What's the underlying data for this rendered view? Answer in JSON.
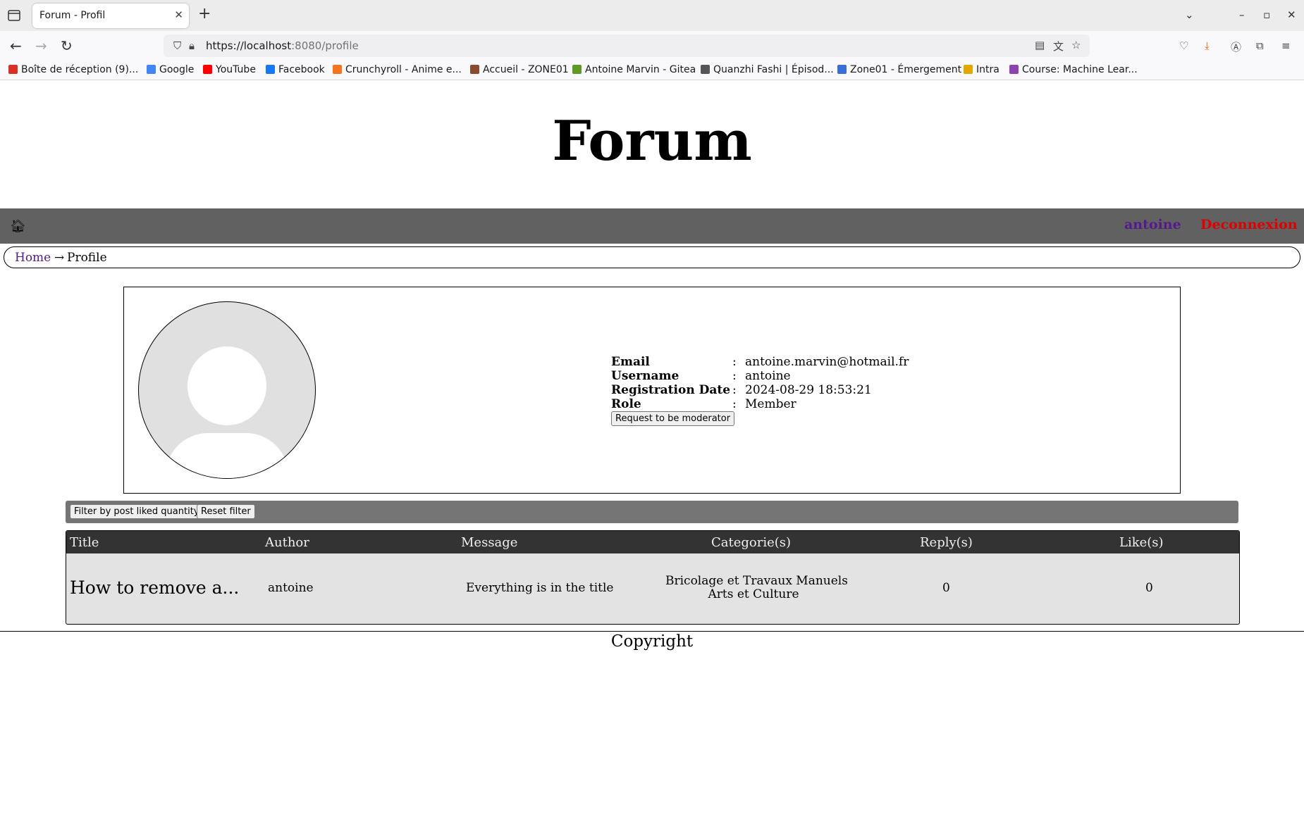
{
  "browser": {
    "tab_title": "Forum - Profil",
    "url_host": "https://localhost",
    "url_path": ":8080/profile",
    "bookmarks": [
      {
        "label": "Boîte de réception (9)...",
        "color": "#d93025"
      },
      {
        "label": "Google",
        "color": "#4285f4"
      },
      {
        "label": "YouTube",
        "color": "#ff0000"
      },
      {
        "label": "Facebook",
        "color": "#1877f2"
      },
      {
        "label": "Crunchyroll - Anime e...",
        "color": "#f47521"
      },
      {
        "label": "Accueil - ZONE01",
        "color": "#8a4b2f"
      },
      {
        "label": "Antoine Marvin - Gitea",
        "color": "#609926"
      },
      {
        "label": "Quanzhi Fashi | Épisod...",
        "color": "#555555"
      },
      {
        "label": "Zone01 - Émergement",
        "color": "#3b6fd8"
      },
      {
        "label": "Intra",
        "color": "#e0a800"
      },
      {
        "label": "Course: Machine Lear...",
        "color": "#8e44ad"
      }
    ]
  },
  "site": {
    "title": "Forum",
    "nav": {
      "username": "antoine",
      "logout": "Deconnexion"
    },
    "breadcrumb": {
      "home": "Home",
      "arrow": "→",
      "current": "Profile"
    }
  },
  "profile": {
    "fields": [
      {
        "label": "Email",
        "value": "antoine.marvin@hotmail.fr"
      },
      {
        "label": "Username",
        "value": "antoine"
      },
      {
        "label": "Registration Date",
        "value": "2024-08-29 18:53:21"
      },
      {
        "label": "Role",
        "value": "Member"
      }
    ],
    "separator": ":",
    "moderator_button": "Request to be moderator"
  },
  "filters": {
    "by_likes": "Filter by post liked quantity",
    "reset": "Reset filter"
  },
  "posts": {
    "headers": [
      "Title",
      "Author",
      "Message",
      "Categorie(s)",
      "Reply(s)",
      "Like(s)"
    ],
    "rows": [
      {
        "title": "How to remove a...",
        "author": "antoine",
        "message": "Everything is in the title",
        "categories": [
          "Bricolage et Travaux Manuels",
          "Arts et Culture"
        ],
        "replies": "0",
        "likes": "0"
      }
    ]
  },
  "footer": {
    "copyright": "Copyright"
  }
}
